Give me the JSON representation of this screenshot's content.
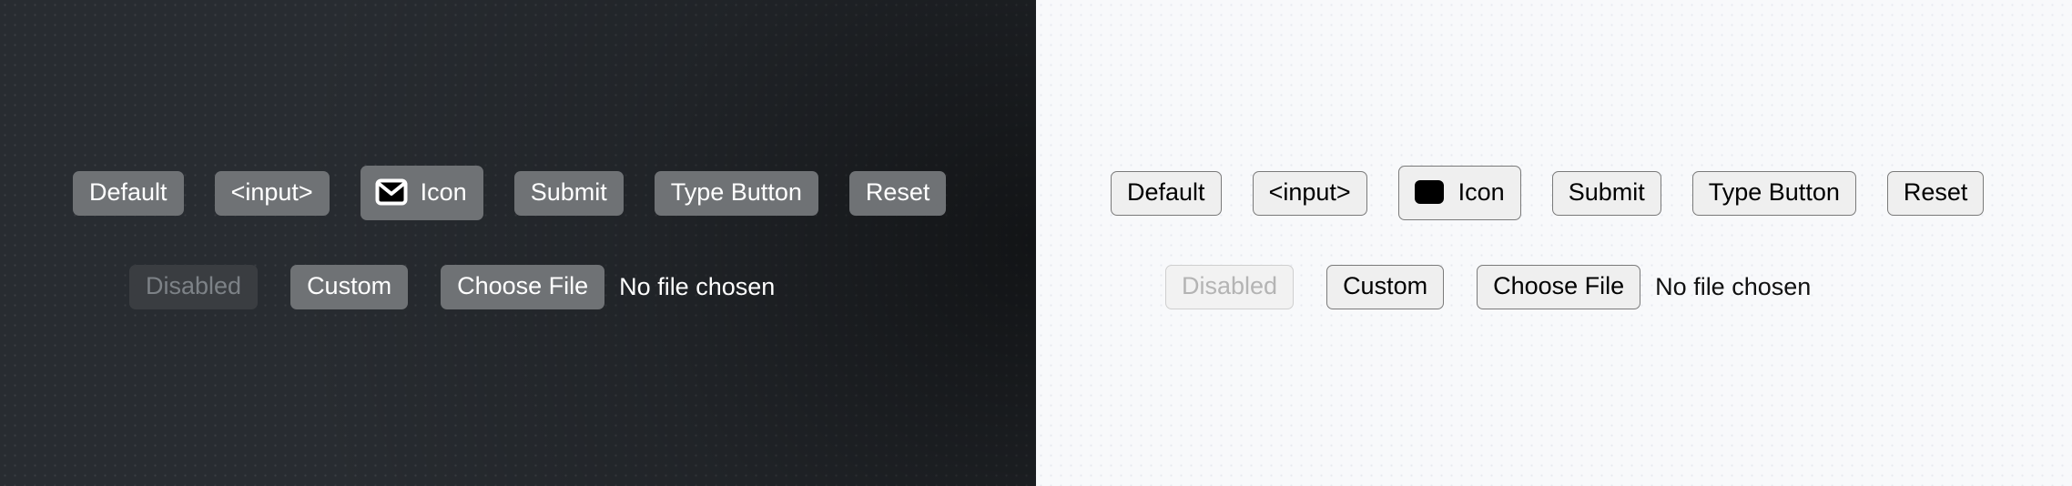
{
  "panels": [
    {
      "theme": "dark",
      "background_color": "#282c31",
      "button_fill": "#6f7275",
      "button_text_color": "#ffffff",
      "disabled_fill": "#3a3d41",
      "disabled_text_color": "#7d8287",
      "icon_name": "mail-icon",
      "rows": [
        {
          "controls": [
            {
              "label": "Default"
            },
            {
              "label": "<input>"
            },
            {
              "label": "Icon",
              "icon": "mail-icon"
            },
            {
              "label": "Submit"
            },
            {
              "label": "Type Button"
            },
            {
              "label": "Reset"
            }
          ]
        },
        {
          "controls": [
            {
              "label": "Disabled",
              "disabled": true
            },
            {
              "label": "Custom"
            },
            {
              "label": "Choose File",
              "file_status": "No file chosen"
            }
          ]
        }
      ]
    },
    {
      "theme": "light",
      "background_color": "#f8f9fb",
      "button_fill": "#efefef",
      "button_border_color": "#7a7a7a",
      "button_text_color": "#000000",
      "disabled_border_color": "#cfcfcf",
      "disabled_text_color": "#b4b4b4",
      "icon_name": "black-rounded-square-icon",
      "rows": [
        {
          "controls": [
            {
              "label": "Default"
            },
            {
              "label": "<input>"
            },
            {
              "label": "Icon",
              "icon": "black-rounded-square-icon"
            },
            {
              "label": "Submit"
            },
            {
              "label": "Type Button"
            },
            {
              "label": "Reset"
            }
          ]
        },
        {
          "controls": [
            {
              "label": "Disabled",
              "disabled": true
            },
            {
              "label": "Custom"
            },
            {
              "label": "Choose File",
              "file_status": "No file chosen"
            }
          ]
        }
      ]
    }
  ],
  "dark": {
    "row1": {
      "default_label": "Default",
      "input_label": "<input>",
      "icon_label": "Icon",
      "submit_label": "Submit",
      "type_button_label": "Type Button",
      "reset_label": "Reset"
    },
    "row2": {
      "disabled_label": "Disabled",
      "custom_label": "Custom",
      "choose_file_label": "Choose File",
      "file_status": "No file chosen"
    }
  },
  "light": {
    "row1": {
      "default_label": "Default",
      "input_label": "<input>",
      "icon_label": "Icon",
      "submit_label": "Submit",
      "type_button_label": "Type Button",
      "reset_label": "Reset"
    },
    "row2": {
      "disabled_label": "Disabled",
      "custom_label": "Custom",
      "choose_file_label": "Choose File",
      "file_status": "No file chosen"
    }
  }
}
